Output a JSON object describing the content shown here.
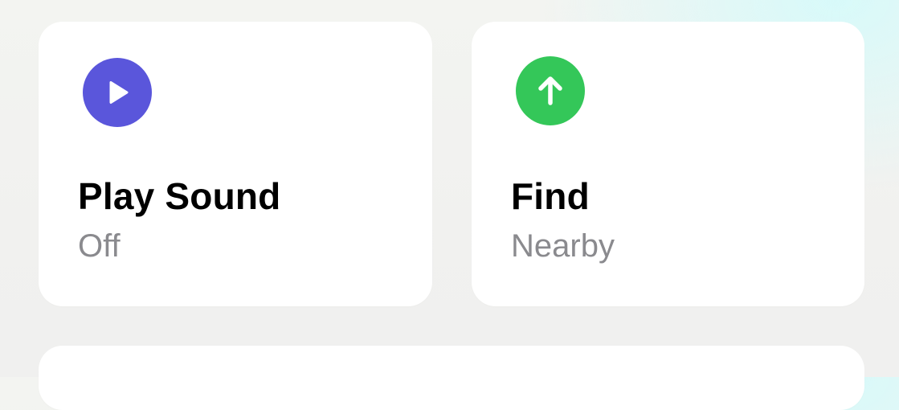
{
  "actions": {
    "play_sound": {
      "title": "Play Sound",
      "status": "Off",
      "icon": "play-icon",
      "color": "#5A56DB"
    },
    "find": {
      "title": "Find",
      "status": "Nearby",
      "icon": "arrow-up-icon",
      "color": "#34C759"
    }
  }
}
